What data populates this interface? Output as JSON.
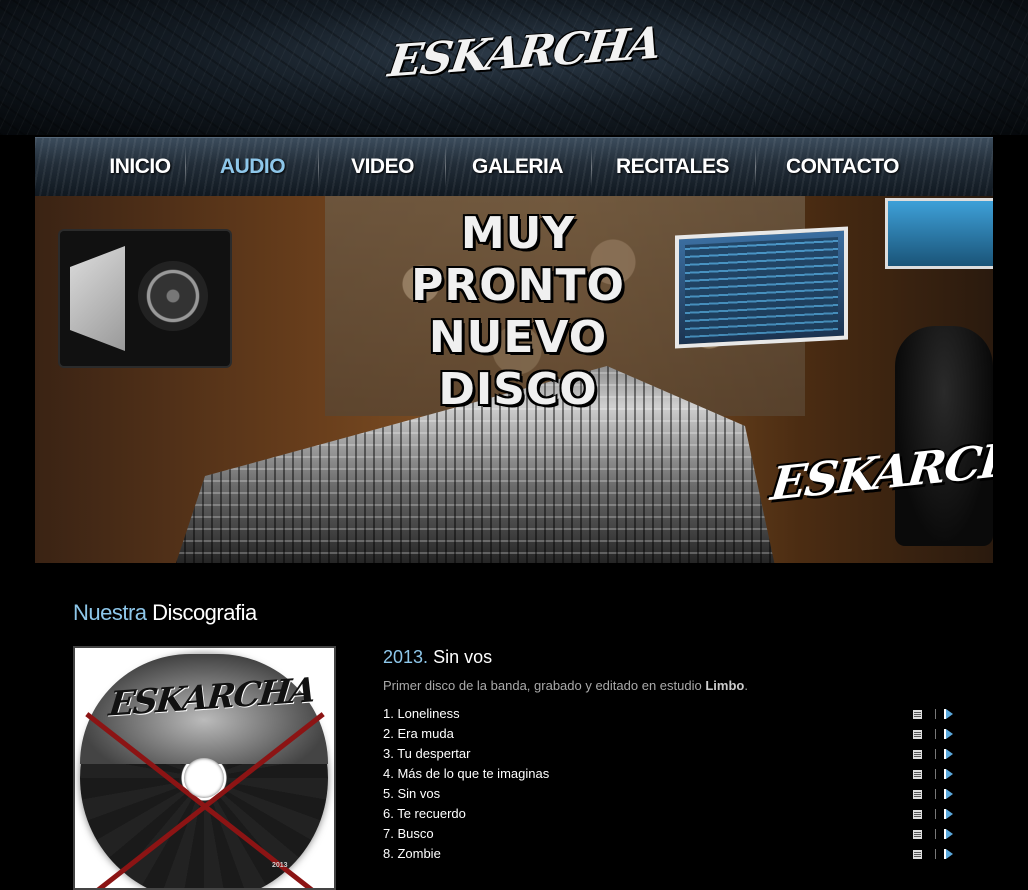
{
  "brand": {
    "logo_text": "ESKARCHA"
  },
  "nav": {
    "items": [
      {
        "label": "INICIO",
        "active": false
      },
      {
        "label": "AUDIO",
        "active": true
      },
      {
        "label": "VIDEO",
        "active": false
      },
      {
        "label": "GALERIA",
        "active": false
      },
      {
        "label": "RECITALES",
        "active": false
      },
      {
        "label": "CONTACTO",
        "active": false
      }
    ]
  },
  "banner": {
    "line1": "MUY PRONTO",
    "line2": "NUEVO DISCO",
    "logo_text": "ESKARCHA"
  },
  "discography": {
    "title_highlight": "Nuestra",
    "title_rest": "Discografia",
    "album": {
      "year": "2013.",
      "name": "Sin vos",
      "description_prefix": "Primer disco de la banda, grabado y editado en estudio",
      "studio": "Limbo",
      "description_suffix": ".",
      "cover_logo": "ESKARCHA",
      "cover_year": "2013",
      "tracks": [
        "1. Loneliness",
        "2. Era muda",
        "3. Tu despertar",
        "4. Más de lo que te imaginas",
        "5. Sin vos",
        "6. Te recuerdo",
        "7. Busco",
        "8. Zombie"
      ]
    }
  },
  "colors": {
    "accent": "#8ec7ea",
    "background": "#000000",
    "play": "#5aa8dc"
  },
  "icons": {
    "lyrics": "lyrics-icon",
    "play": "play-icon"
  }
}
